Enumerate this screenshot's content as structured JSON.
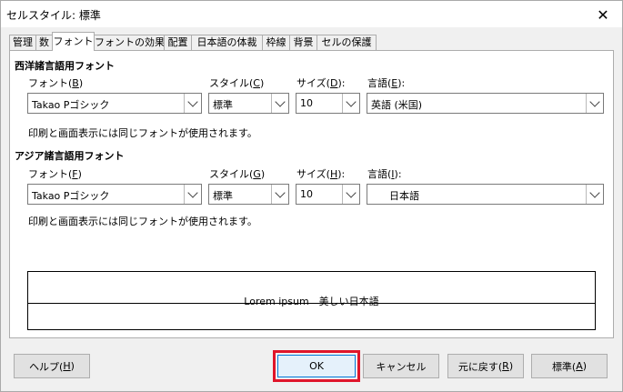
{
  "window": {
    "title": "セルスタイル: 標準"
  },
  "tabs": [
    {
      "label": "管理"
    },
    {
      "label": "数"
    },
    {
      "label": "フォント"
    },
    {
      "label": "フォントの効果"
    },
    {
      "label": "配置"
    },
    {
      "label": "日本語の体裁"
    },
    {
      "label": "枠線"
    },
    {
      "label": "背景"
    },
    {
      "label": "セルの保護"
    }
  ],
  "western": {
    "section_title": "西洋諸言語用フォント",
    "font_label": "フォント(",
    "font_key": "B",
    "font_value": "Takao Pゴシック",
    "style_label": "スタイル(",
    "style_key": "C",
    "style_value": "標準",
    "size_label": "サイズ(",
    "size_key": "D",
    "size_value": "10",
    "lang_label": "言語(",
    "lang_key": "E",
    "lang_value": "英語 (米国)",
    "info": "印刷と画面表示には同じフォントが使用されます。"
  },
  "asian": {
    "section_title": "アジア諸言語用フォント",
    "font_label": "フォント(",
    "font_key": "F",
    "font_value": "Takao Pゴシック",
    "style_label": "スタイル(",
    "style_key": "G",
    "style_value": "標準",
    "size_label": "サイズ(",
    "size_key": "H",
    "size_value": "10",
    "lang_label": "言語(",
    "lang_key": "I",
    "lang_value": "日本語",
    "info": "印刷と画面表示には同じフォントが使用されます。"
  },
  "label_close": "):",
  "label_close_plain": ")",
  "preview": {
    "text": "Lorem ipsum　美しい日本語"
  },
  "buttons": {
    "help_label": "ヘルプ(",
    "help_key": "H",
    "ok_label": "OK",
    "cancel_label": "キャンセル",
    "reset_label": "元に戻す(",
    "reset_key": "R",
    "standard_label": "標準(",
    "standard_key": "A"
  },
  "colors": {
    "highlight": "#e0152a",
    "ok_border": "#0078d7"
  }
}
